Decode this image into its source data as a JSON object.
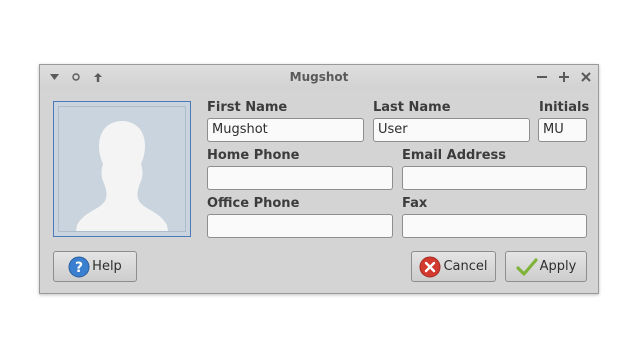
{
  "window": {
    "title": "Mugshot",
    "controls": [
      "menu-icon",
      "stick-icon",
      "shade-icon",
      "minimize-icon",
      "maximize-icon",
      "close-icon"
    ]
  },
  "avatar": {
    "icon": "user-silhouette-icon"
  },
  "form": {
    "first_name": {
      "label": "First Name",
      "value": "Mugshot"
    },
    "last_name": {
      "label": "Last Name",
      "value": "User"
    },
    "initials": {
      "label": "Initials",
      "value": "MU"
    },
    "home_phone": {
      "label": "Home Phone",
      "value": ""
    },
    "email": {
      "label": "Email Address",
      "value": ""
    },
    "office_phone": {
      "label": "Office Phone",
      "value": ""
    },
    "fax": {
      "label": "Fax",
      "value": ""
    }
  },
  "buttons": {
    "help": {
      "label": "Help",
      "icon": "help-icon",
      "icon_color": "#3b7fd0"
    },
    "cancel": {
      "label": "Cancel",
      "icon": "cancel-icon",
      "icon_color": "#d23a2f"
    },
    "apply": {
      "label": "Apply",
      "icon": "check-icon",
      "icon_color": "#7fb33a"
    }
  }
}
